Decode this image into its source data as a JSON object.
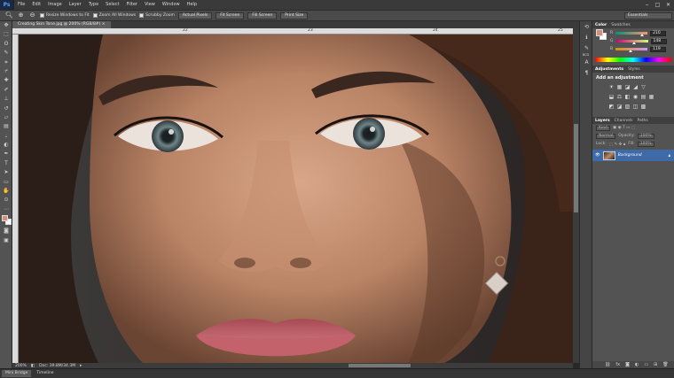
{
  "app": {
    "logo": "Ps"
  },
  "menu": [
    "File",
    "Edit",
    "Image",
    "Layer",
    "Type",
    "Select",
    "Filter",
    "View",
    "Window",
    "Help"
  ],
  "window_controls": {
    "minimize": "‒",
    "maximize": "□",
    "close": "✕"
  },
  "options_bar": {
    "tool_icon": "zoom-icon",
    "zoom_in_icon": "zoom-in-icon",
    "zoom_out_icon": "zoom-out-icon",
    "resize_windows_label": "Resize Windows to Fit",
    "zoom_all_windows_label": "Zoom All Windows",
    "scrubby_zoom_label": "Scrubby Zoom",
    "buttons": [
      "Actual Pixels",
      "Fit Screen",
      "Fill Screen",
      "Print Size"
    ],
    "workspace": "Essentials"
  },
  "document": {
    "tab_title": "Creating Skin Tone.jpg @ 200% (RGB/8#)",
    "ruler_marks": [
      "22",
      "23",
      "24",
      "25"
    ],
    "zoom": "200%",
    "doc_size": "Doc: 39.8M/34.3M"
  },
  "bottom_tabs": [
    "Mini Bridge",
    "Timeline"
  ],
  "panels": {
    "color_tabs": [
      "Color",
      "Swatches"
    ],
    "color": {
      "fg_color": "#d2907c",
      "bg_color": "#ffffff",
      "channels": [
        {
          "label": "R",
          "value": "210",
          "fraction": 0.82
        },
        {
          "label": "G",
          "value": "148",
          "fraction": 0.58
        },
        {
          "label": "B",
          "value": "119",
          "fraction": 0.47
        }
      ]
    },
    "adjustments_tabs": [
      "Adjustments",
      "Styles"
    ],
    "adjustments_title": "Add an adjustment",
    "adjustment_icons_row1": [
      "☀",
      "▦",
      "◪",
      "◢",
      "▽"
    ],
    "adjustment_icons_row2": [
      "⬓",
      "⚖",
      "◧",
      "◉",
      "▤",
      "▦"
    ],
    "adjustment_icons_row3": [
      "◩",
      "◪",
      "▧",
      "◫",
      "▩"
    ],
    "layers_tabs": [
      "Layers",
      "Channels",
      "Paths"
    ],
    "layers": {
      "kind_label": "Kind",
      "blend_mode": "Normal",
      "opacity_label": "Opacity:",
      "opacity_value": "100%",
      "lock_label": "Lock:",
      "fill_label": "Fill:",
      "fill_value": "100%",
      "items": [
        {
          "name": "Background"
        }
      ]
    }
  },
  "icon_strip": {
    "labels": [
      "BCD"
    ]
  }
}
